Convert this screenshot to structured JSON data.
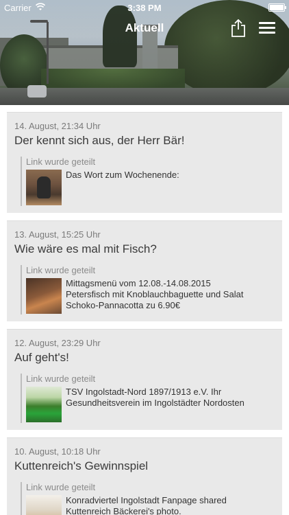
{
  "status_bar": {
    "carrier": "Carrier",
    "time": "3:38 PM"
  },
  "header": {
    "title": "Aktuell"
  },
  "icons": {
    "wifi": "wifi-icon",
    "battery": "battery-icon",
    "share": "share-icon",
    "menu": "hamburger-menu-icon"
  },
  "colors": {
    "card_background": "#e9e9e9",
    "date_text": "#7a7a7a",
    "title_text": "#3a3a3a",
    "header_text": "#ffffff"
  },
  "posts": [
    {
      "date": "14. August, 21:34 Uhr",
      "title": "Der kennt sich aus, der Herr Bär!",
      "shared_label": "Link wurde geteilt",
      "link_lines": [
        "Das Wort zum Wochenende:"
      ]
    },
    {
      "date": "13. August, 15:25 Uhr",
      "title": "Wie wäre es mal mit Fisch?",
      "shared_label": "Link wurde geteilt",
      "link_lines": [
        "Mittagsmenü vom 12.08.-14.08.2015",
        "Petersfisch mit Knoblauchbaguette und Salat",
        "Schoko-Pannacotta zu 6.90€"
      ]
    },
    {
      "date": "12. August, 23:29 Uhr",
      "title": "Auf geht's!",
      "shared_label": "Link wurde geteilt",
      "link_lines": [
        "TSV Ingolstadt-Nord 1897/1913 e.V. Ihr",
        "Gesundheitsverein im Ingolstädter Nordosten"
      ]
    },
    {
      "date": "10. August, 10:18 Uhr",
      "title": "Kuttenreich's Gewinnspiel",
      "shared_label": "Link wurde geteilt",
      "link_lines": [
        "Konradviertel Ingolstadt Fanpage shared",
        "Kuttenreich Bäckerei's photo."
      ]
    }
  ]
}
